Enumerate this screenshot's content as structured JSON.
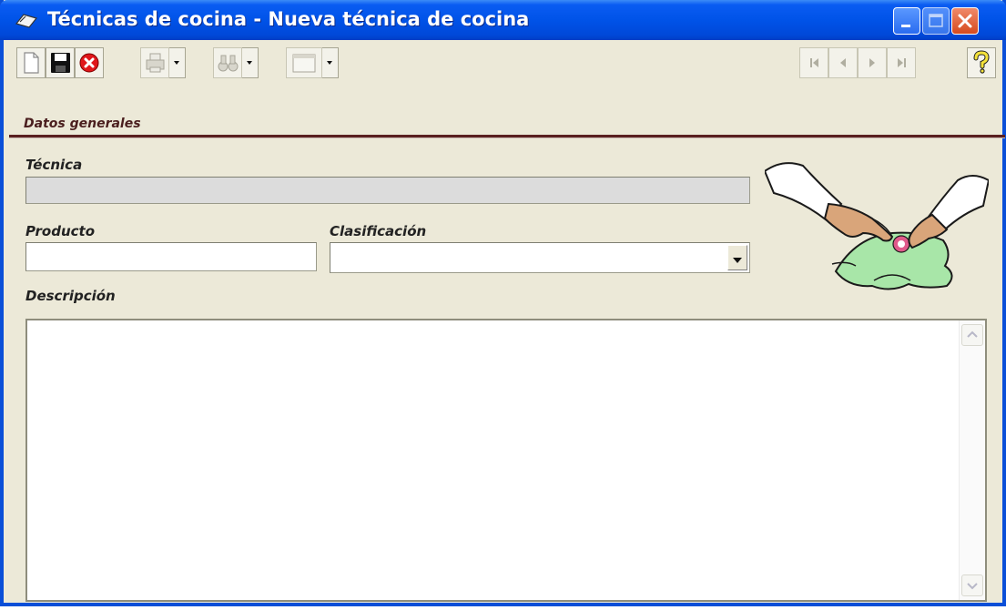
{
  "window": {
    "title": "Técnicas de cocina - Nueva técnica de cocina"
  },
  "toolbar": {
    "icons": [
      "new-document-icon",
      "save-icon",
      "cancel-icon",
      "print-icon",
      "find-icon",
      "view-icon"
    ],
    "nav_icons": [
      "first-record-icon",
      "previous-record-icon",
      "next-record-icon",
      "last-record-icon",
      "help-icon"
    ]
  },
  "section": {
    "title": "Datos generales"
  },
  "form": {
    "tecnica_label": "Técnica",
    "tecnica_value": "",
    "producto_label": "Producto",
    "producto_value": "",
    "clasificacion_label": "Clasificación",
    "clasificacion_value": "",
    "descripcion_label": "Descripción",
    "descripcion_value": ""
  },
  "colors": {
    "title_bar": "#0053e8",
    "window_bg": "#ece9d8",
    "section_rule": "#5a2020",
    "close_button": "#d64a1e"
  }
}
